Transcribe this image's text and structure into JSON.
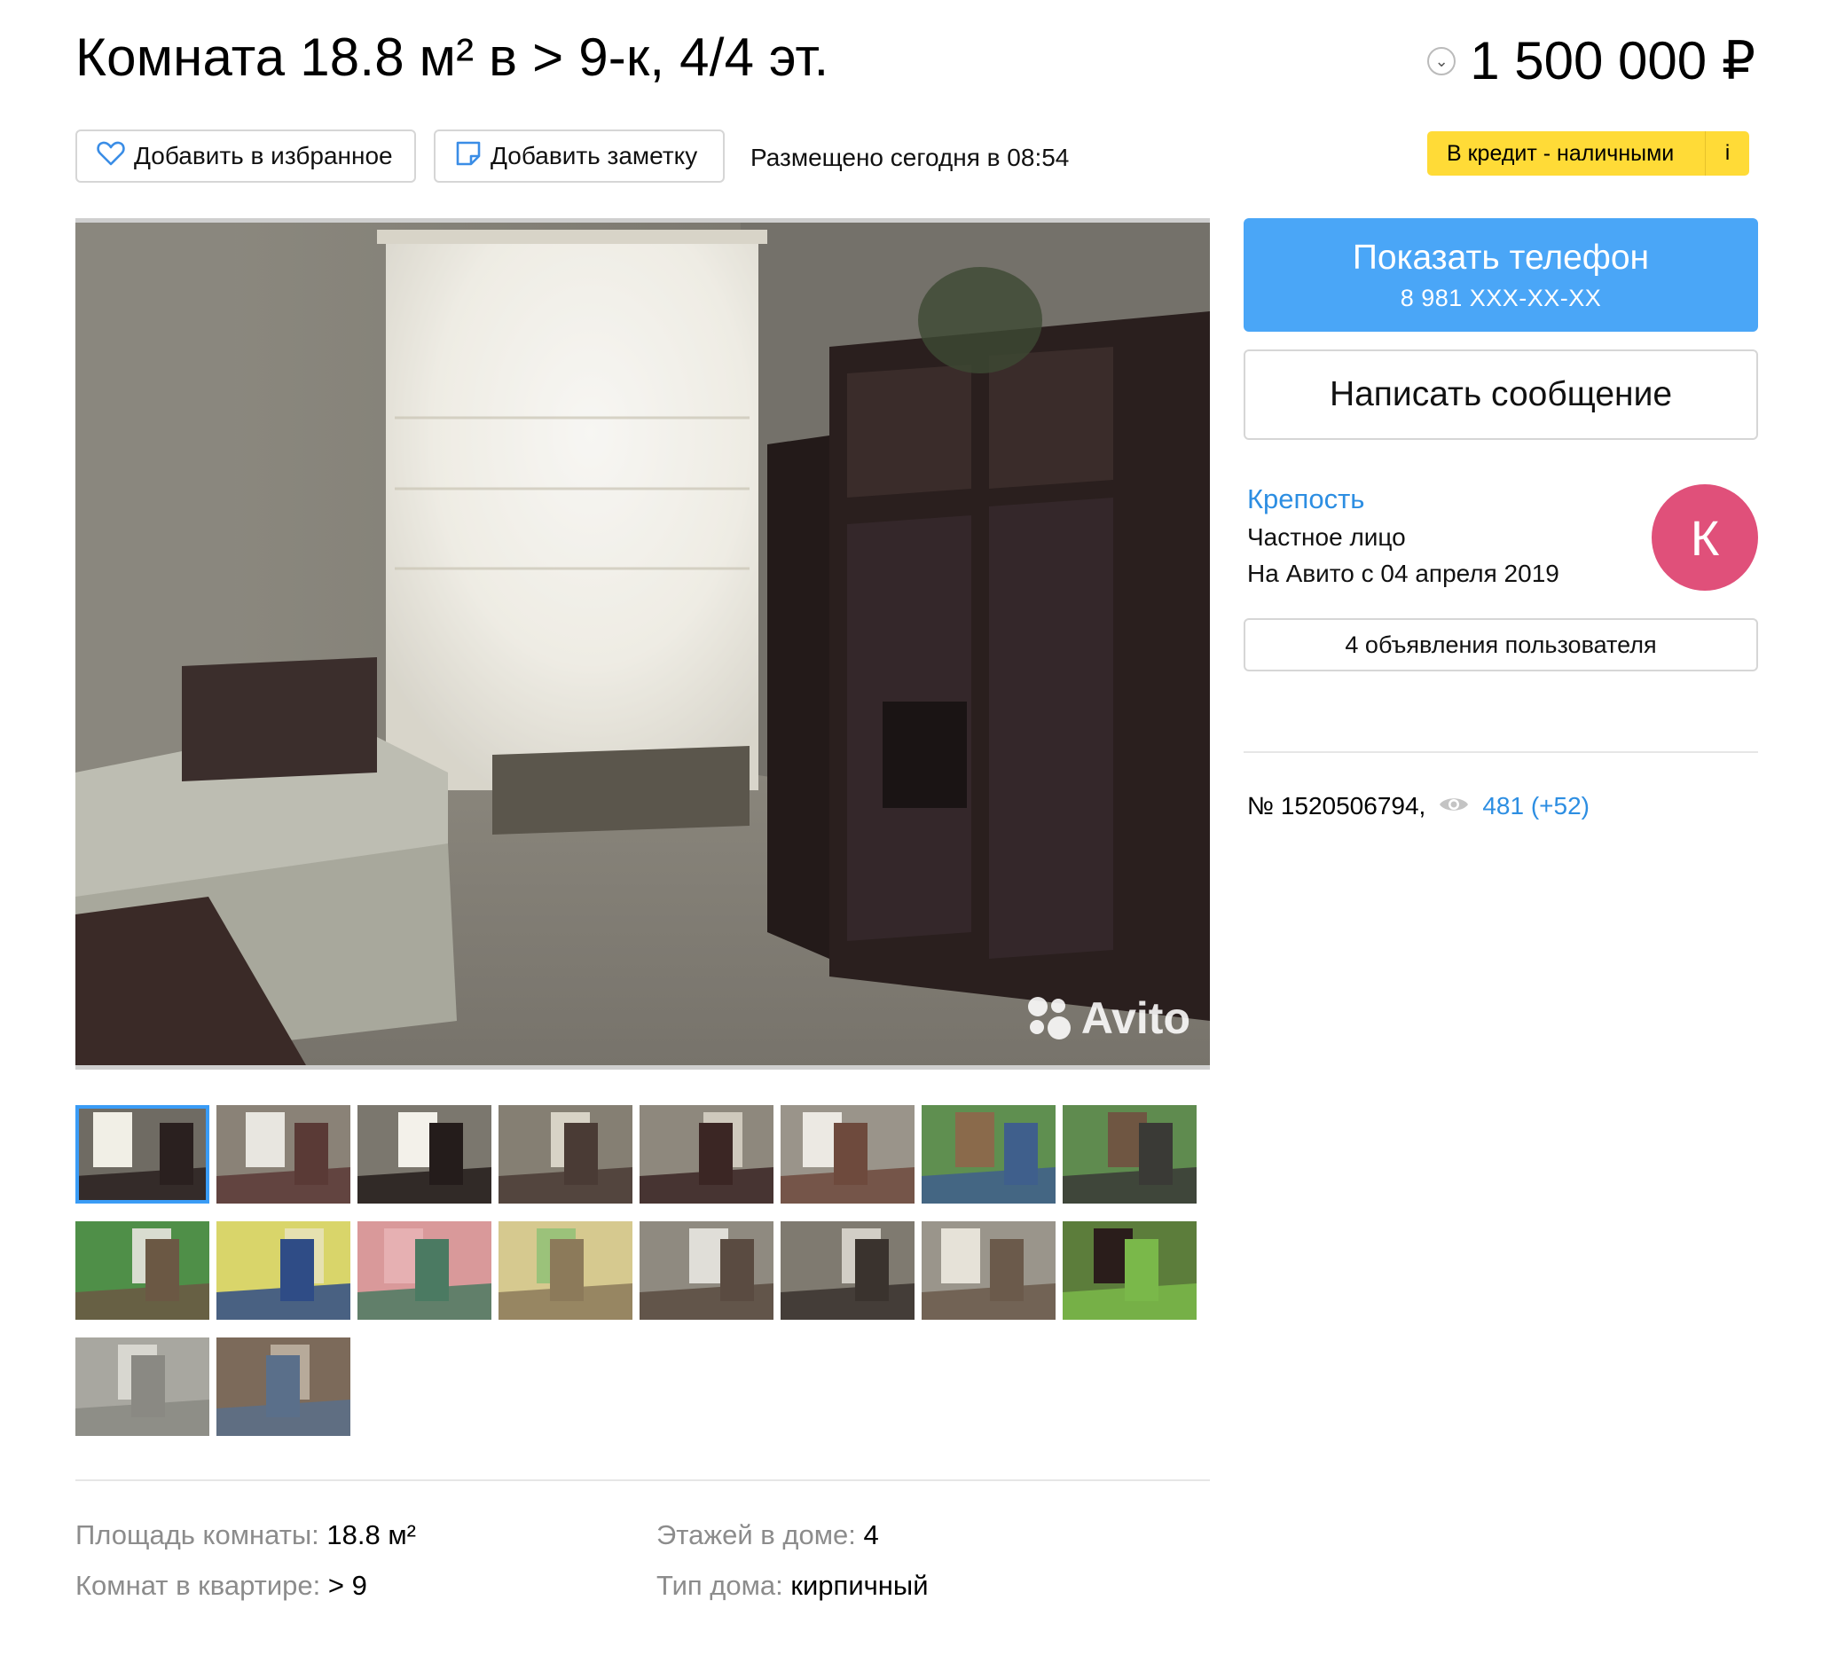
{
  "listing": {
    "title": "Комната 18.8 м² в > 9-к, 4/4 эт.",
    "price": "1 500 000 ₽",
    "posted": "Размещено сегодня в 08:54",
    "number": "№ 1520506794,",
    "views": "481 (+52)"
  },
  "actions": {
    "favorite_label": "Добавить в избранное",
    "note_label": "Добавить заметку",
    "credit_label": "В кредит - наличными",
    "credit_info": "i"
  },
  "contact": {
    "phone_button": "Показать телефон",
    "phone_masked": "8 981 XXX-XX-XX",
    "message_button": "Написать сообщение"
  },
  "seller": {
    "name": "Крепость",
    "type": "Частное лицо",
    "since": "На Авито с 04 апреля 2019",
    "avatar_letter": "К",
    "avatar_color": "#e0507a",
    "ads_button": "4 объявления пользователя"
  },
  "gallery": {
    "watermark": "Avito",
    "selected_index": 0,
    "thumb_count": 18
  },
  "params": [
    {
      "key": "Площадь комнаты:",
      "value": "18.8 м²"
    },
    {
      "key": "Этажей в доме:",
      "value": "4"
    },
    {
      "key": "Комнат в квартире:",
      "value": "> 9"
    },
    {
      "key": "Тип дома:",
      "value": "кирпичный"
    }
  ],
  "colors": {
    "accent_blue": "#4aa6f7",
    "link_blue": "#2d8ee2",
    "credit_yellow": "#ffdb37"
  }
}
